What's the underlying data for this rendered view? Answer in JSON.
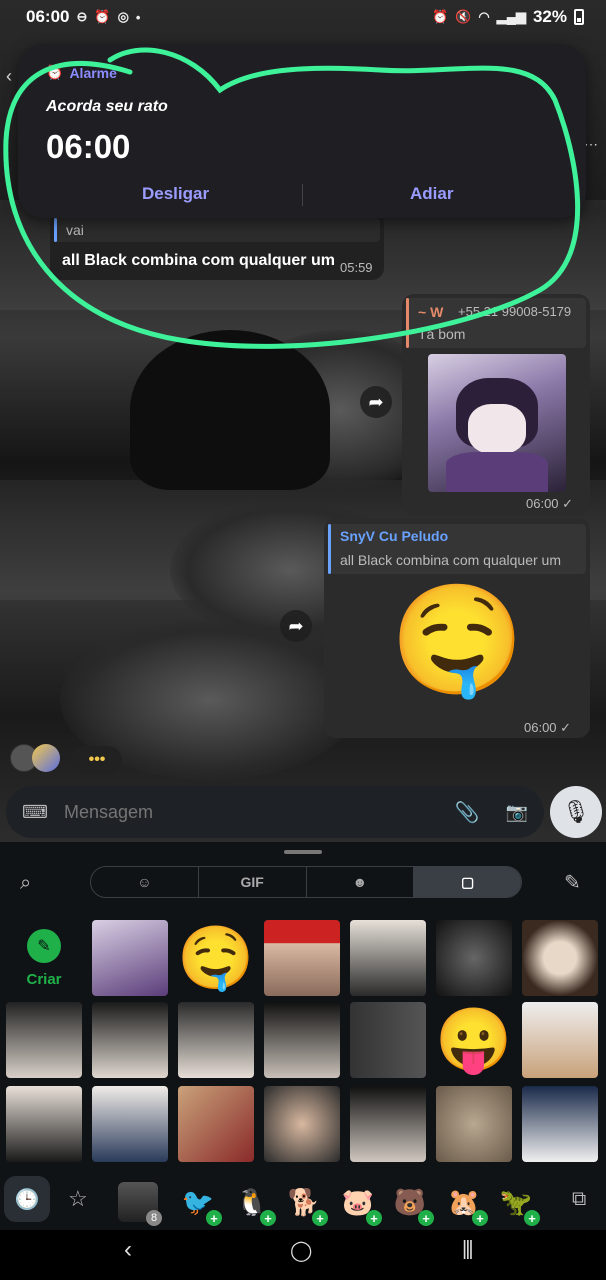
{
  "status_bar": {
    "time": "06:00",
    "battery": "32%"
  },
  "alarm": {
    "app_label": "Alarme",
    "name": "Acorda seu rato",
    "time": "06:00",
    "dismiss_label": "Desligar",
    "snooze_label": "Adiar"
  },
  "messages": {
    "first": {
      "reply_text": "vai",
      "text": "all Black combina com qualquer um",
      "time": "05:59"
    },
    "second": {
      "reply_name": "~ W",
      "reply_phone": "+55 21 99008-5179",
      "reply_text": "Tá bom",
      "time": "06:00 ✓"
    },
    "third": {
      "reply_name": "SnyV Cu Peludo",
      "reply_text": "all Black combina com qualquer um",
      "sticker": "🤤",
      "time": "06:00 ✓"
    }
  },
  "typing_indicator": "•••",
  "composer": {
    "placeholder": "Mensagem"
  },
  "keyboard": {
    "tabs": [
      "☺",
      "GIF",
      "☻",
      "▢"
    ],
    "create_label": "Criar",
    "pack_badge": "8",
    "accent_color": "#20b04a"
  },
  "colors": {
    "alarm_accent": "#8a8cff",
    "scribble": "#3ef29a",
    "reply_bar_blue": "#6aa2ff",
    "reply_bar_orange": "#e48a6a"
  }
}
